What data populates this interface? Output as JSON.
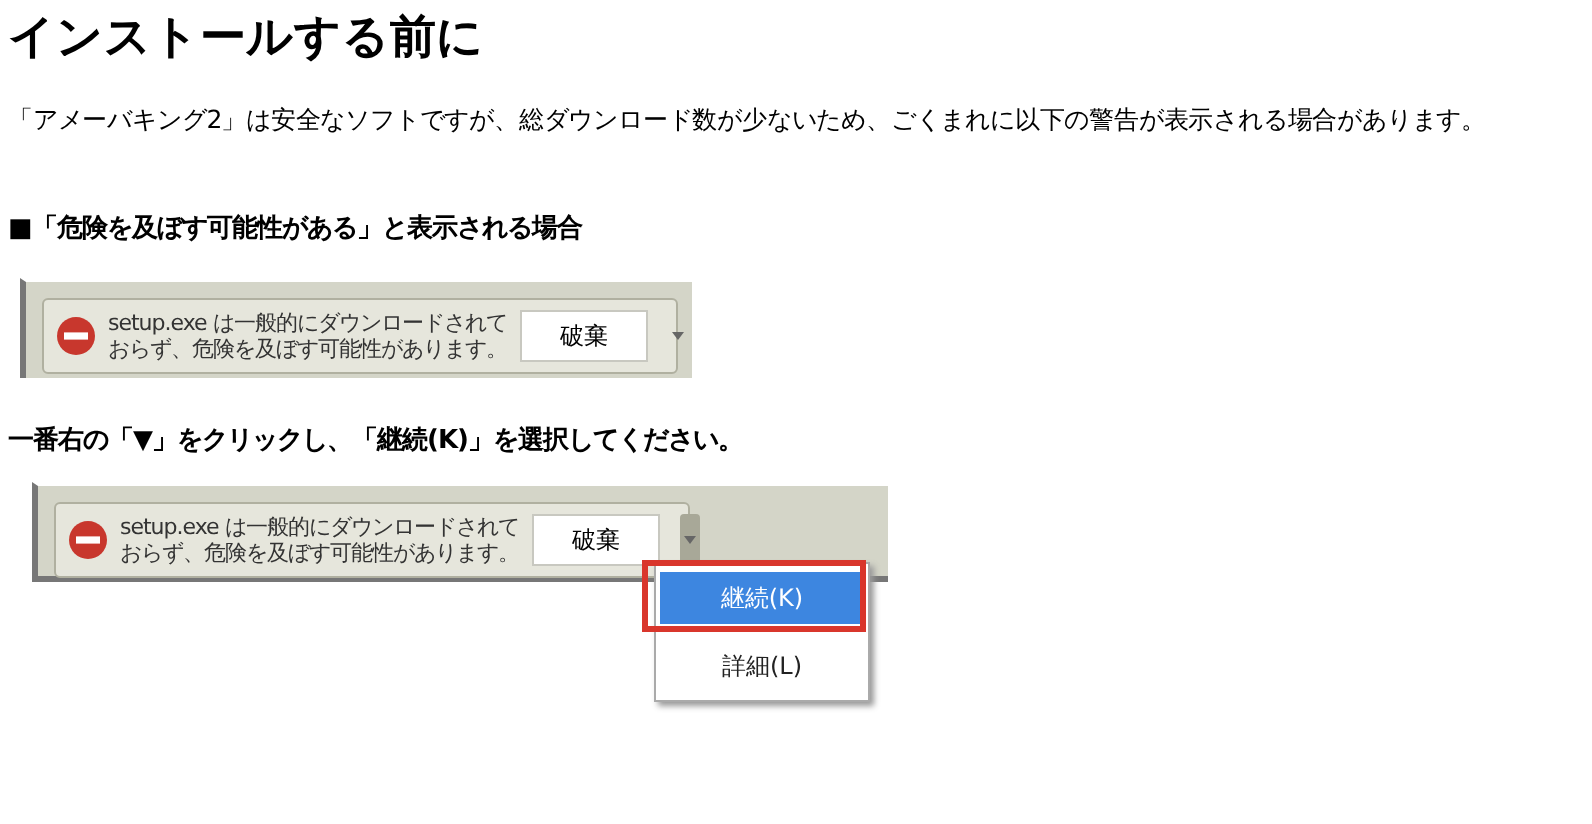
{
  "title": "インストールする前に",
  "intro": "「アメーバキング2」は安全なソフトですが、総ダウンロード数が少ないため、ごくまれに以下の警告が表示される場合があります。",
  "section_heading": "■「危険を及ぼす可能性がある」と表示される場合",
  "screenshots": [
    {
      "message": "setup.exe は一般的にダウンロードされておらず、危険を及ぼす可能性があります。",
      "button": "破棄"
    },
    {
      "caption": "一番右の「▼」をクリックし、「継続(K)」を選択してください。",
      "message": "setup.exe は一般的にダウンロードされておらず、危険を及ぼす可能性があります。",
      "button": "破棄",
      "menu": [
        {
          "label": "継続(K)",
          "selected": true
        },
        {
          "label": "詳細(L)",
          "selected": false
        }
      ]
    }
  ]
}
